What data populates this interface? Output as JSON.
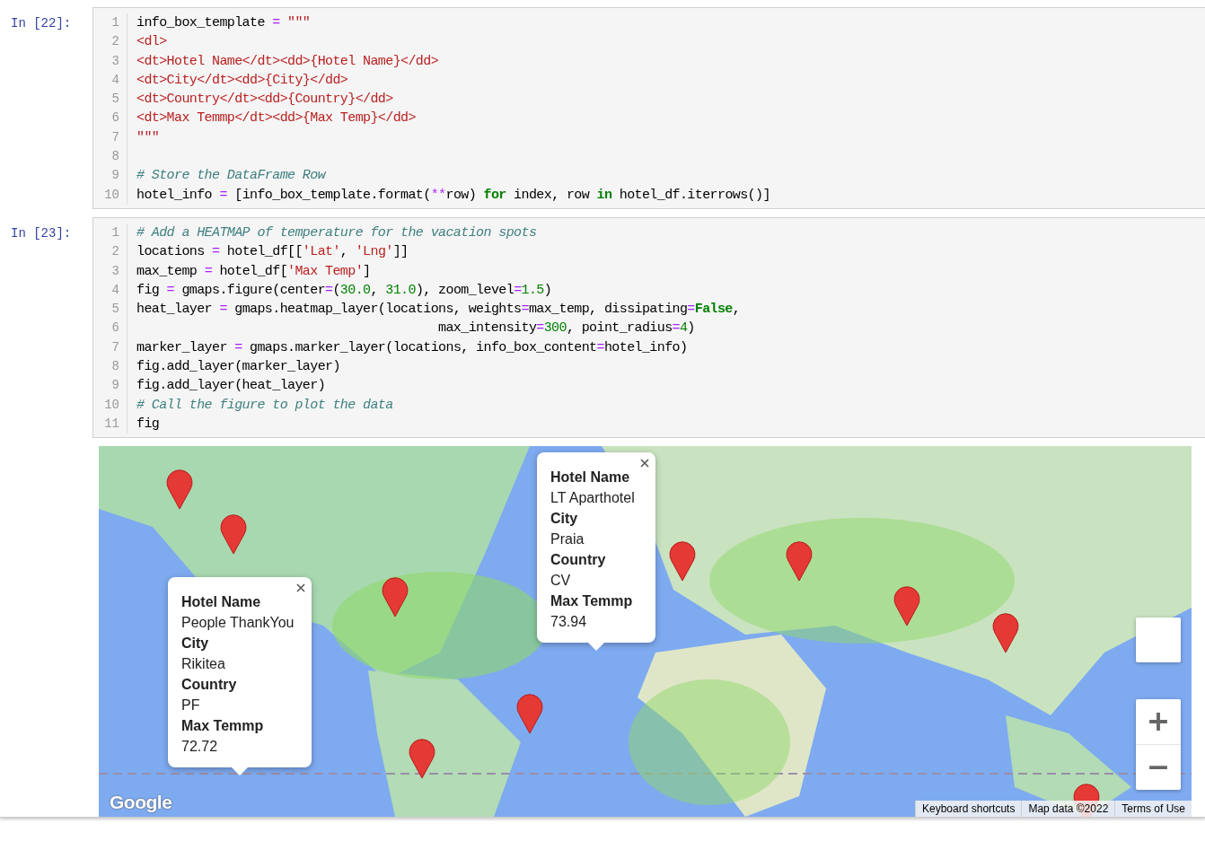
{
  "cells": [
    {
      "prompt": "In [22]:",
      "lines": [
        {
          "number": "1",
          "tokens": [
            {
              "text": "info_box_template ",
              "kind": "plain"
            },
            {
              "text": "=",
              "kind": "op"
            },
            {
              "text": " \"\"\"",
              "kind": "str"
            }
          ]
        },
        {
          "number": "2",
          "tokens": [
            {
              "text": "<dl>",
              "kind": "str"
            }
          ]
        },
        {
          "number": "3",
          "tokens": [
            {
              "text": "<dt>Hotel Name</dt><dd>{Hotel Name}</dd>",
              "kind": "str"
            }
          ]
        },
        {
          "number": "4",
          "tokens": [
            {
              "text": "<dt>City</dt><dd>{City}</dd>",
              "kind": "str"
            }
          ]
        },
        {
          "number": "5",
          "tokens": [
            {
              "text": "<dt>Country</dt><dd>{Country}</dd>",
              "kind": "str"
            }
          ]
        },
        {
          "number": "6",
          "tokens": [
            {
              "text": "<dt>Max Temmp</dt><dd>{Max Temp}</dd>",
              "kind": "str"
            }
          ]
        },
        {
          "number": "7",
          "tokens": [
            {
              "text": "\"\"\"",
              "kind": "str"
            }
          ]
        },
        {
          "number": "8"
        },
        {
          "number": "9",
          "tokens": [
            {
              "text": "# Store the DataFrame Row",
              "kind": "cmt"
            }
          ]
        },
        {
          "number": "10",
          "tokens": [
            {
              "text": "hotel_info ",
              "kind": "plain"
            },
            {
              "text": "=",
              "kind": "op"
            },
            {
              "text": " [info_box_template.format(",
              "kind": "plain"
            },
            {
              "text": "**",
              "kind": "op"
            },
            {
              "text": "row) ",
              "kind": "plain"
            },
            {
              "text": "for",
              "kind": "kw"
            },
            {
              "text": " index, row ",
              "kind": "plain"
            },
            {
              "text": "in",
              "kind": "kw"
            },
            {
              "text": " hotel_df.iterrows()]",
              "kind": "plain"
            }
          ]
        }
      ]
    },
    {
      "prompt": "In [23]:",
      "lines": [
        {
          "number": "1",
          "tokens": [
            {
              "text": "# Add a HEATMAP of temperature for the vacation spots",
              "kind": "cmt"
            }
          ]
        },
        {
          "number": "2",
          "tokens": [
            {
              "text": "locations ",
              "kind": "plain"
            },
            {
              "text": "=",
              "kind": "op"
            },
            {
              "text": " hotel_df[[",
              "kind": "plain"
            },
            {
              "text": "'Lat'",
              "kind": "str"
            },
            {
              "text": ", ",
              "kind": "plain"
            },
            {
              "text": "'Lng'",
              "kind": "str"
            },
            {
              "text": "]]",
              "kind": "plain"
            }
          ]
        },
        {
          "number": "3",
          "tokens": [
            {
              "text": "max_temp ",
              "kind": "plain"
            },
            {
              "text": "=",
              "kind": "op"
            },
            {
              "text": " hotel_df[",
              "kind": "plain"
            },
            {
              "text": "'Max Temp'",
              "kind": "str"
            },
            {
              "text": "]",
              "kind": "plain"
            }
          ]
        },
        {
          "number": "4",
          "tokens": [
            {
              "text": "fig ",
              "kind": "plain"
            },
            {
              "text": "=",
              "kind": "op"
            },
            {
              "text": " gmaps.figure(center",
              "kind": "plain"
            },
            {
              "text": "=",
              "kind": "op"
            },
            {
              "text": "(",
              "kind": "plain"
            },
            {
              "text": "30.0",
              "kind": "num"
            },
            {
              "text": ", ",
              "kind": "plain"
            },
            {
              "text": "31.0",
              "kind": "num"
            },
            {
              "text": "), zoom_level",
              "kind": "plain"
            },
            {
              "text": "=",
              "kind": "op"
            },
            {
              "text": "1.5",
              "kind": "num"
            },
            {
              "text": ")",
              "kind": "plain"
            }
          ]
        },
        {
          "number": "5",
          "tokens": [
            {
              "text": "heat_layer ",
              "kind": "plain"
            },
            {
              "text": "=",
              "kind": "op"
            },
            {
              "text": " gmaps.heatmap_layer(locations, weights",
              "kind": "plain"
            },
            {
              "text": "=",
              "kind": "op"
            },
            {
              "text": "max_temp, dissipating",
              "kind": "plain"
            },
            {
              "text": "=",
              "kind": "op"
            },
            {
              "text": "False",
              "kind": "kw"
            },
            {
              "text": ",",
              "kind": "plain"
            }
          ]
        },
        {
          "number": "6",
          "tokens": [
            {
              "text": "                                        max_intensity",
              "kind": "plain"
            },
            {
              "text": "=",
              "kind": "op"
            },
            {
              "text": "300",
              "kind": "num"
            },
            {
              "text": ", point_radius",
              "kind": "plain"
            },
            {
              "text": "=",
              "kind": "op"
            },
            {
              "text": "4",
              "kind": "num"
            },
            {
              "text": ")",
              "kind": "plain"
            }
          ]
        },
        {
          "number": "7",
          "tokens": [
            {
              "text": "marker_layer ",
              "kind": "plain"
            },
            {
              "text": "=",
              "kind": "op"
            },
            {
              "text": " gmaps.marker_layer(locations, info_box_content",
              "kind": "plain"
            },
            {
              "text": "=",
              "kind": "op"
            },
            {
              "text": "hotel_info)",
              "kind": "plain"
            }
          ]
        },
        {
          "number": "8",
          "tokens": [
            {
              "text": "fig.add_layer(marker_layer)",
              "kind": "plain"
            }
          ]
        },
        {
          "number": "9",
          "tokens": [
            {
              "text": "fig.add_layer(heat_layer)",
              "kind": "plain"
            }
          ]
        },
        {
          "number": "10",
          "tokens": [
            {
              "text": "# Call the figure to plot the data",
              "kind": "cmt"
            }
          ]
        },
        {
          "number": "11",
          "tokens": [
            {
              "text": "fig",
              "kind": "plain"
            }
          ]
        }
      ]
    }
  ],
  "map": {
    "kind": "picture",
    "info_windows": [
      {
        "fields": [
          {
            "label": "Hotel Name",
            "value": "People ThankYou"
          },
          {
            "label": "City",
            "value": "Rikitea"
          },
          {
            "label": "Country",
            "value": "PF"
          },
          {
            "label": "Max Temmp",
            "value": "72.72"
          }
        ]
      },
      {
        "fields": [
          {
            "label": "Hotel Name",
            "value": "LT Aparthotel"
          },
          {
            "label": "City",
            "value": "Praia"
          },
          {
            "label": "Country",
            "value": "CV"
          },
          {
            "label": "Max Temmp",
            "value": "73.94"
          }
        ]
      }
    ],
    "logo": "Google",
    "footer_links": [
      "Keyboard shortcuts",
      "Map data ©2022",
      "Terms of Use"
    ]
  }
}
